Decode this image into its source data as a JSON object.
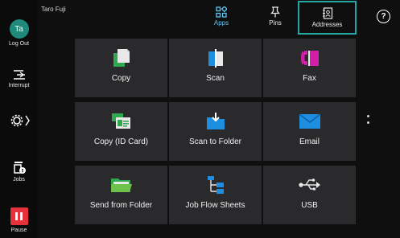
{
  "user": {
    "name": "Taro Fuji",
    "initials": "Ta"
  },
  "sidebar": {
    "logout_label": "Log Out",
    "interrupt_label": "Interrupt",
    "jobs_label": "Jobs",
    "pause_label": "Pause"
  },
  "tabs": [
    {
      "label": "Apps",
      "selected": true
    },
    {
      "label": "Pins",
      "selected": false
    },
    {
      "label": "Addresses",
      "selected": false
    }
  ],
  "help": {
    "label": "?"
  },
  "apps": [
    {
      "label": "Copy",
      "icon": "copy-icon"
    },
    {
      "label": "Scan",
      "icon": "scan-icon"
    },
    {
      "label": "Fax",
      "icon": "fax-icon"
    },
    {
      "label": "Copy (ID Card)",
      "icon": "id-card-copy-icon"
    },
    {
      "label": "Scan to Folder",
      "icon": "scan-to-folder-icon"
    },
    {
      "label": "Email",
      "icon": "email-icon"
    },
    {
      "label": "Send from Folder",
      "icon": "send-from-folder-icon"
    },
    {
      "label": "Job Flow Sheets",
      "icon": "job-flow-sheets-icon"
    },
    {
      "label": "USB",
      "icon": "usb-icon"
    }
  ],
  "colors": {
    "accent_tab": "#5ec5f5",
    "highlight_border": "#25a8a4",
    "tile_bg": "#2a2a2c",
    "pause_red": "#e5313c",
    "avatar_teal": "#1f8a7c"
  }
}
